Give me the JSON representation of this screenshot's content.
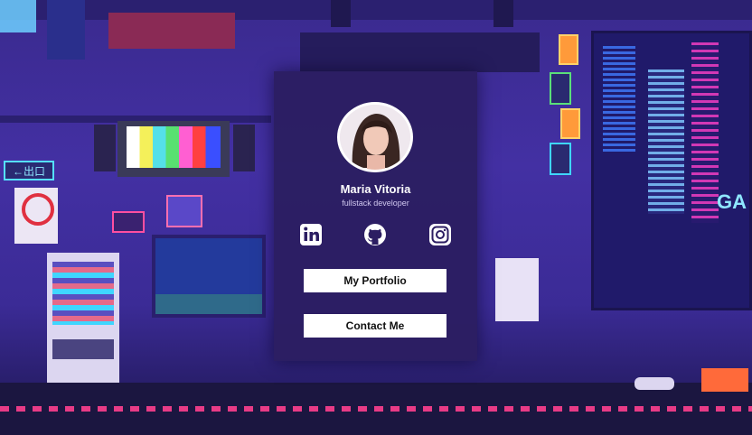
{
  "profile": {
    "name": "Maria Vitoria",
    "role": "fullstack developer"
  },
  "social_links": [
    {
      "icon": "linkedin-icon"
    },
    {
      "icon": "github-icon"
    },
    {
      "icon": "instagram-icon"
    }
  ],
  "buttons": {
    "portfolio_label": "My Portfolio",
    "contact_label": "Contact Me"
  },
  "scene": {
    "exit_sign": "←出口",
    "shop_sign": "GA",
    "colors": {
      "accent_pink": "#ff3f8e",
      "neon_cyan": "#3fd6ff",
      "card_bg": "#2c1e62"
    }
  }
}
